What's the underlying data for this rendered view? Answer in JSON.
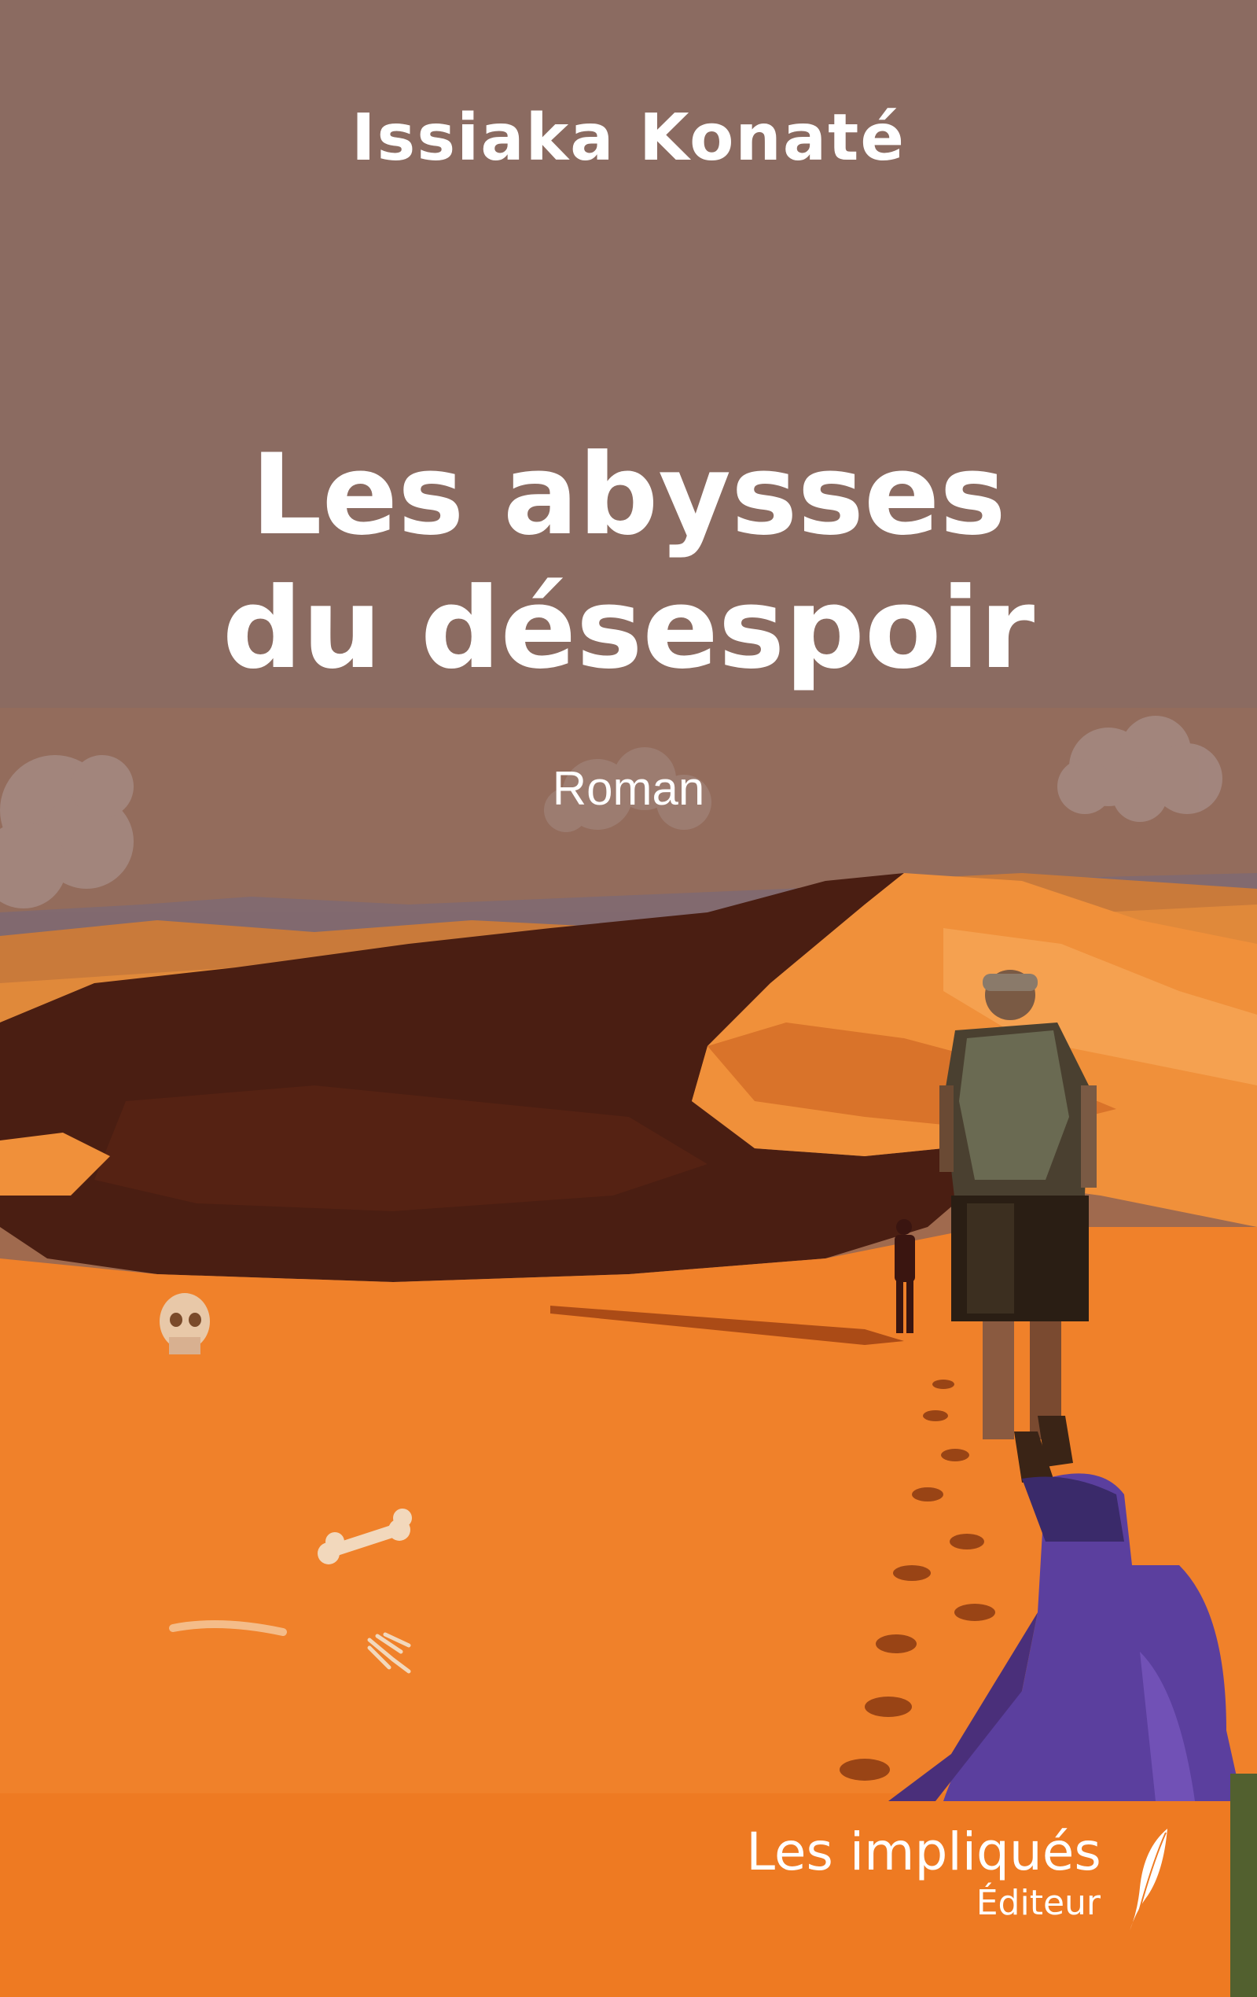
{
  "book": {
    "author": "Issiaka Konaté",
    "title_line1": "Les abysses",
    "title_line2": "du désespoir",
    "genre": "Roman",
    "publisher_name": "Les impliqués",
    "publisher_sub": "Éditeur"
  },
  "colors": {
    "accent_bar": "#52602f",
    "sky": "#8a6b62",
    "sand": "#f0812a",
    "dune_shadow": "#4a1e12",
    "text": "#ffffff"
  },
  "illustration": {
    "icons": [
      "cloud-icon",
      "skull-icon",
      "bone-icon",
      "hand-bones-icon",
      "feather-icon"
    ]
  }
}
